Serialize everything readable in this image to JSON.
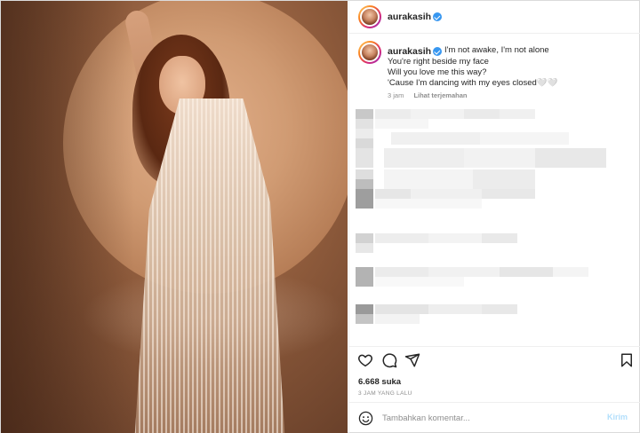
{
  "post": {
    "username": "aurakasih",
    "verified": true,
    "caption_lines": [
      "I'm not awake, I'm not alone",
      "You're right beside my face",
      "Will you love me this way?",
      "'Cause I'm dancing with my eyes closed🤍🤍"
    ],
    "caption_time": "3 jam",
    "translate_label": "Lihat terjemahan",
    "likes": "6.668 suka",
    "time_ago": "3 JAM YANG LALU"
  },
  "composer": {
    "placeholder": "Tambahkan komentar...",
    "post_label": "Kirim"
  },
  "icons": {
    "like": "heart-icon",
    "comment": "comment-icon",
    "share": "paper-plane-icon",
    "save": "bookmark-icon",
    "emoji": "smiley-icon",
    "verified": "verified-badge-icon"
  },
  "colors": {
    "verified_blue": "#3897f0",
    "muted_text": "#8e8e8e",
    "post_button_disabled": "#b2dffc"
  }
}
